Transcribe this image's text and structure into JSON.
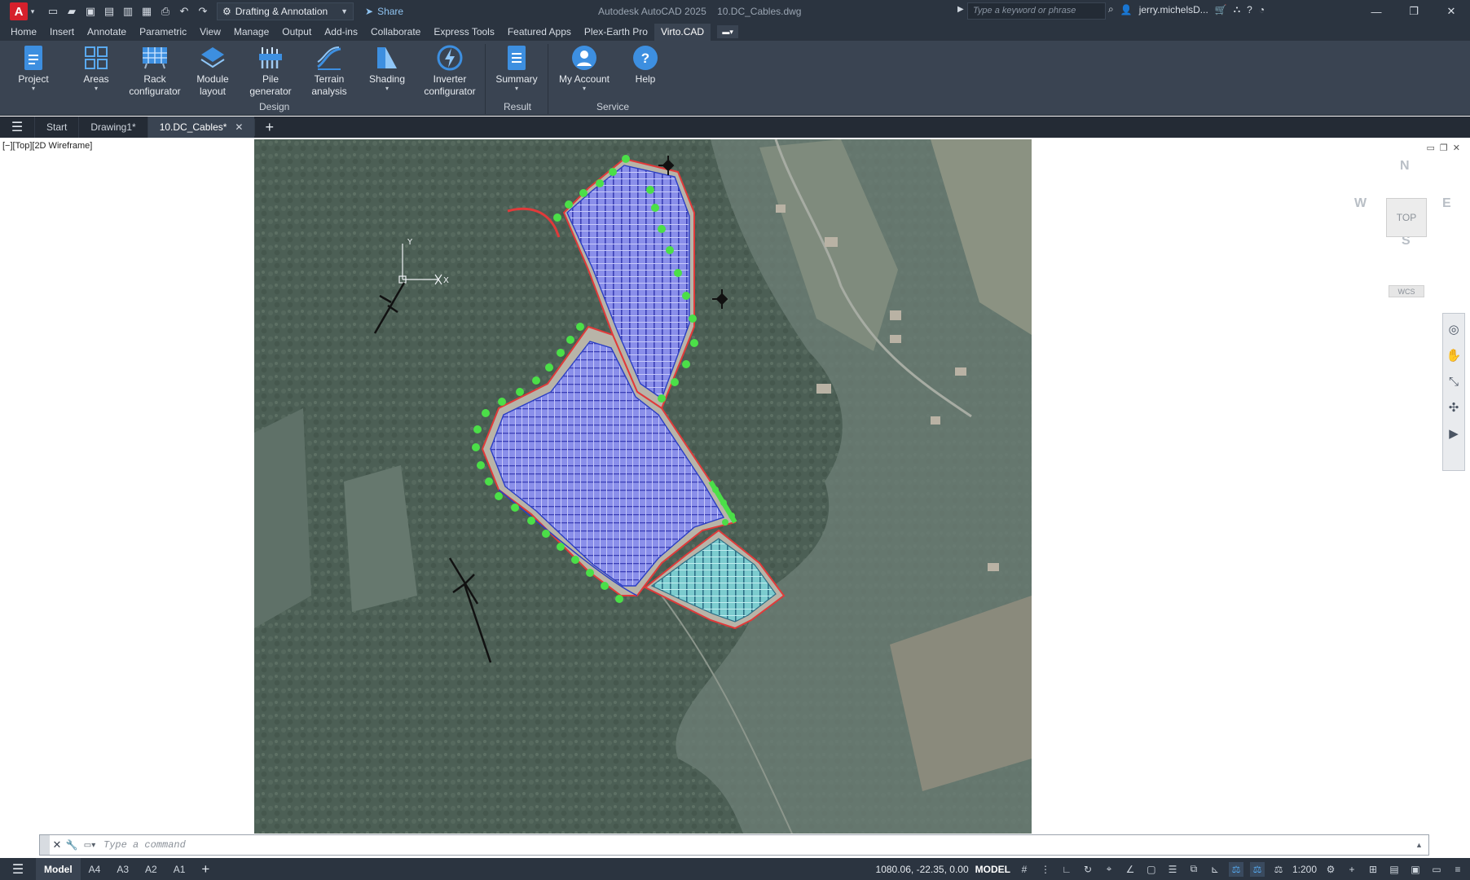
{
  "titlebar": {
    "app_logo": "A",
    "workspace": "Drafting & Annotation",
    "share": "Share",
    "title": "Autodesk AutoCAD 2025    10.DC_Cables.dwg",
    "search_placeholder": "Type a keyword or phrase",
    "user": "jerry.michelsD...",
    "window_controls": [
      "minimize-icon",
      "restore-icon",
      "close-icon"
    ]
  },
  "ribbon_tabs": [
    "Home",
    "Insert",
    "Annotate",
    "Parametric",
    "View",
    "Manage",
    "Output",
    "Add-ins",
    "Collaborate",
    "Express Tools",
    "Featured Apps",
    "Plex-Earth Pro",
    "Virto.CAD"
  ],
  "active_ribbon_tab": "Virto.CAD",
  "ribbon": {
    "project": "Project",
    "areas": "Areas",
    "rack": "Rack\nconfigurator",
    "module": "Module\nlayout",
    "pile": "Pile\ngenerator",
    "terrain": "Terrain\nanalysis",
    "shading": "Shading",
    "inverter": "Inverter\nconfigurator",
    "summary": "Summary",
    "account": "My Account",
    "help": "Help",
    "panels": {
      "design": "Design",
      "result": "Result",
      "service": "Service"
    }
  },
  "doc_tabs": {
    "start": "Start",
    "drawing1": "Drawing1*",
    "active": "10.DC_Cables*"
  },
  "viewport": {
    "label": "[−][Top][2D Wireframe]",
    "viewcube": {
      "n": "N",
      "s": "S",
      "e": "E",
      "w": "W",
      "top": "TOP",
      "wcs": "WCS"
    },
    "ucs": {
      "x": "X",
      "y": "Y"
    }
  },
  "command": {
    "placeholder": "Type a command"
  },
  "statusbar": {
    "layouts": [
      "Model",
      "A4",
      "A3",
      "A2",
      "A1"
    ],
    "active_layout": "Model",
    "coords": "1080.06, -22.35, 0.00",
    "mode": "MODEL",
    "scale": "1:200"
  },
  "colors": {
    "chrome_dark": "#2b3440",
    "ribbon": "#3a4452",
    "accent_blue": "#55a8ec",
    "boundary_red": "#e03a3a",
    "tree_green": "#45e04a",
    "module_blue": "#6f73e8"
  }
}
